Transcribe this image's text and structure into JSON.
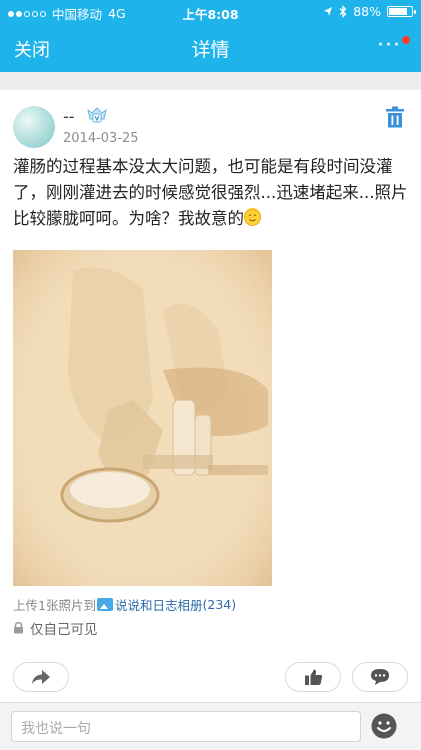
{
  "status_bar": {
    "carrier": "中国移动",
    "network": "4G",
    "time": "上午8:08",
    "battery": "88%",
    "battery_level": 0.88
  },
  "nav": {
    "close_label": "关闭",
    "title": "详情",
    "more_label": "···"
  },
  "post": {
    "author": "--",
    "date": "2014-03-25",
    "text": "灌肠的过程基本没太大问题，也可能是有段时间没灌了，刚刚灌进去的时候感觉很强烈...迅速堵起来...照片比较朦胧呵呵。为啥？我故意的",
    "upload_prefix": "上传1张照片到",
    "album_name": "说说和日志相册",
    "album_count": "(234)",
    "privacy": "仅自己可见"
  },
  "comment_input": {
    "placeholder": "我也说一句"
  },
  "colors": {
    "brand": "#1fb3ec",
    "link": "#2e6aa8"
  },
  "icons": [
    "location-arrow-icon",
    "bluetooth-icon",
    "battery-icon",
    "more-icon",
    "vip-badge-icon",
    "trash-icon",
    "album-icon",
    "lock-icon",
    "share-icon",
    "like-icon",
    "comment-icon",
    "emoji-icon"
  ]
}
